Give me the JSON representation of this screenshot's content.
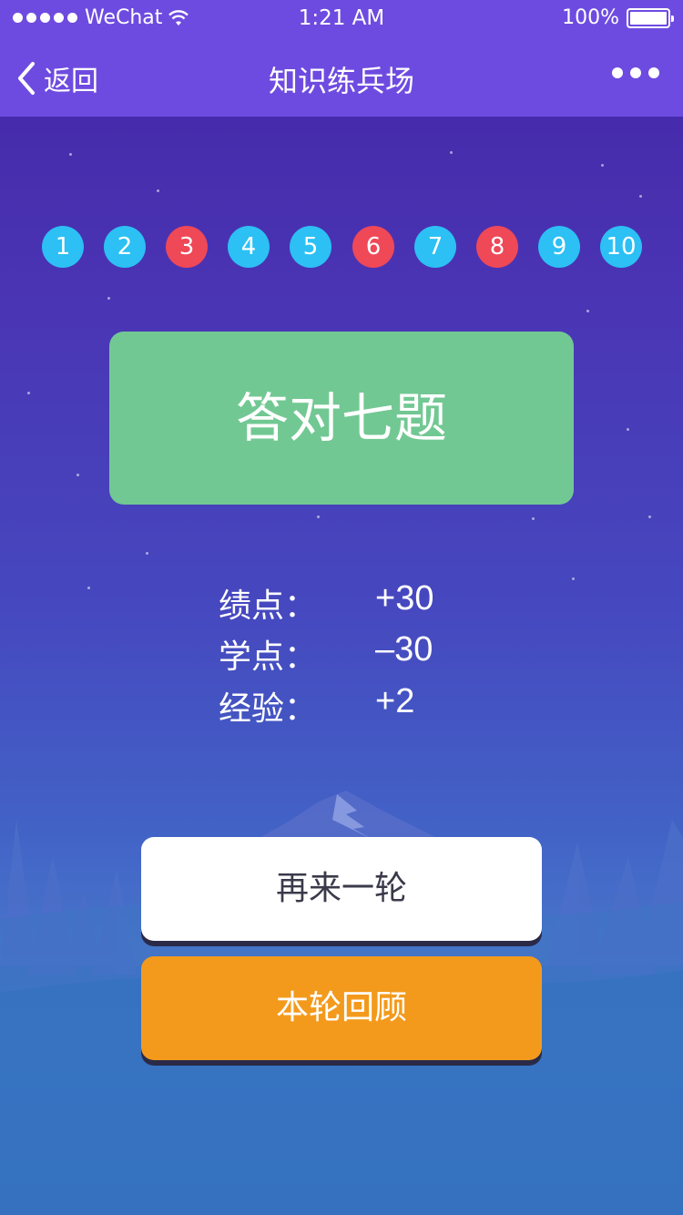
{
  "status_bar": {
    "carrier": "WeChat",
    "time": "1:21 AM",
    "battery": "100%"
  },
  "nav": {
    "back_label": "返回",
    "title": "知识练兵场"
  },
  "questions": [
    {
      "number": "1",
      "status": "correct"
    },
    {
      "number": "2",
      "status": "correct"
    },
    {
      "number": "3",
      "status": "wrong"
    },
    {
      "number": "4",
      "status": "correct"
    },
    {
      "number": "5",
      "status": "correct"
    },
    {
      "number": "6",
      "status": "wrong"
    },
    {
      "number": "7",
      "status": "correct"
    },
    {
      "number": "8",
      "status": "wrong"
    },
    {
      "number": "9",
      "status": "correct"
    },
    {
      "number": "10",
      "status": "correct"
    }
  ],
  "result": {
    "text": "答对七题"
  },
  "stats": [
    {
      "label": "绩点：",
      "value": "+30"
    },
    {
      "label": "学点：",
      "value": "–30"
    },
    {
      "label": "经验：",
      "value": "+2"
    }
  ],
  "buttons": {
    "retry": "再来一轮",
    "review": "本轮回顾"
  },
  "colors": {
    "nav_bg": "#6e4be0",
    "correct": "#2cc0f4",
    "wrong": "#ef4857",
    "result_card": "#72c893",
    "review_button": "#f39a1c"
  }
}
